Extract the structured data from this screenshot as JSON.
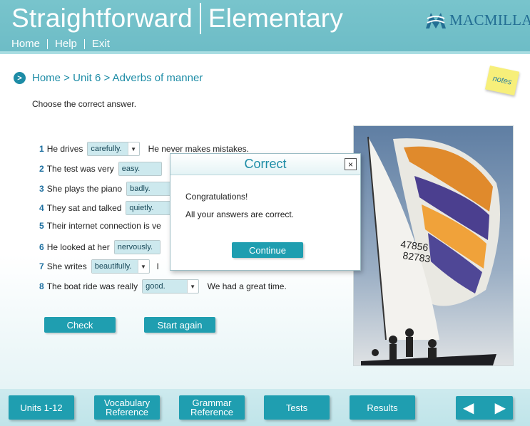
{
  "header": {
    "brand_left": "Straightforward",
    "brand_right": "Elementary",
    "publisher": "MACMILLAN",
    "nav": [
      "Home",
      "Help",
      "Exit"
    ]
  },
  "breadcrumb": "Home > Unit 6 > Adverbs of manner",
  "notes_label": "notes",
  "instruction": "Choose the correct answer.",
  "questions": [
    {
      "num": "1",
      "before": "He drives",
      "answer": "carefully.",
      "after": "He never makes mistakes."
    },
    {
      "num": "2",
      "before": "The test was very",
      "answer": "easy.",
      "after": ""
    },
    {
      "num": "3",
      "before": "She plays the piano",
      "answer": "badly.",
      "after": ""
    },
    {
      "num": "4",
      "before": "They sat and talked",
      "answer": "quietly.",
      "after": ""
    },
    {
      "num": "5",
      "before": "Their internet connection is ve",
      "answer": "",
      "after": ""
    },
    {
      "num": "6",
      "before": "He looked at her",
      "answer": "nervously.",
      "after": ""
    },
    {
      "num": "7",
      "before": "She writes",
      "answer": "beautifully.",
      "after": "I"
    },
    {
      "num": "8",
      "before": "The boat ride was really",
      "answer": "good.",
      "after": "We had a great time."
    }
  ],
  "buttons": {
    "check": "Check",
    "start_again": "Start again"
  },
  "dialog": {
    "title": "Correct",
    "close": "×",
    "line1": "Congratulations!",
    "line2": "All your answers are correct.",
    "continue": "Continue"
  },
  "bottom_tabs": {
    "units": "Units 1-12",
    "vocab_1": "Vocabulary",
    "vocab_2": "Reference",
    "grammar_1": "Grammar",
    "grammar_2": "Reference",
    "tests": "Tests",
    "results": "Results"
  },
  "colors": {
    "teal_header": "#78c4cc",
    "button": "#1f9eb0",
    "link": "#1d8ca6",
    "logo": "#246f94"
  }
}
